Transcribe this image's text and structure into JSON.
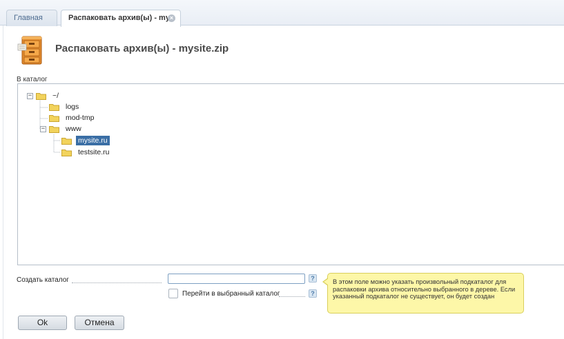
{
  "tabs": {
    "home_label": "Главная",
    "active_label": "Распаковать архив(ы) - my...",
    "close_glyph": "×"
  },
  "header": {
    "title": "Распаковать архив(ы) - mysite.zip",
    "icon": "file-cabinet-icon"
  },
  "tree": {
    "section_label": "В каталог",
    "nodes": [
      {
        "label": "~/",
        "expanded": true,
        "toggle": "−"
      },
      {
        "label": "logs"
      },
      {
        "label": "mod-tmp"
      },
      {
        "label": "www",
        "expanded": true,
        "toggle": "−"
      },
      {
        "label": "mysite.ru",
        "selected": true
      },
      {
        "label": "testsite.ru"
      }
    ]
  },
  "form": {
    "create_dir_label": "Создать каталог",
    "create_dir_value": "",
    "create_dir_placeholder": "",
    "goto_label": "Перейти в выбранный каталог",
    "goto_checked": false,
    "help_glyph": "?"
  },
  "tooltip": {
    "text": "В этом поле можно указать произвольный подкаталог для распаковки архива относительно выбранного в дереве. Если указанный подкаталог не существует, он будет создан"
  },
  "buttons": {
    "ok_label": "Ok",
    "cancel_label": "Отмена"
  },
  "colors": {
    "selection": "#3a6ea5",
    "folder": "#f2d35c",
    "tooltip_bg": "#fdf7a8"
  }
}
